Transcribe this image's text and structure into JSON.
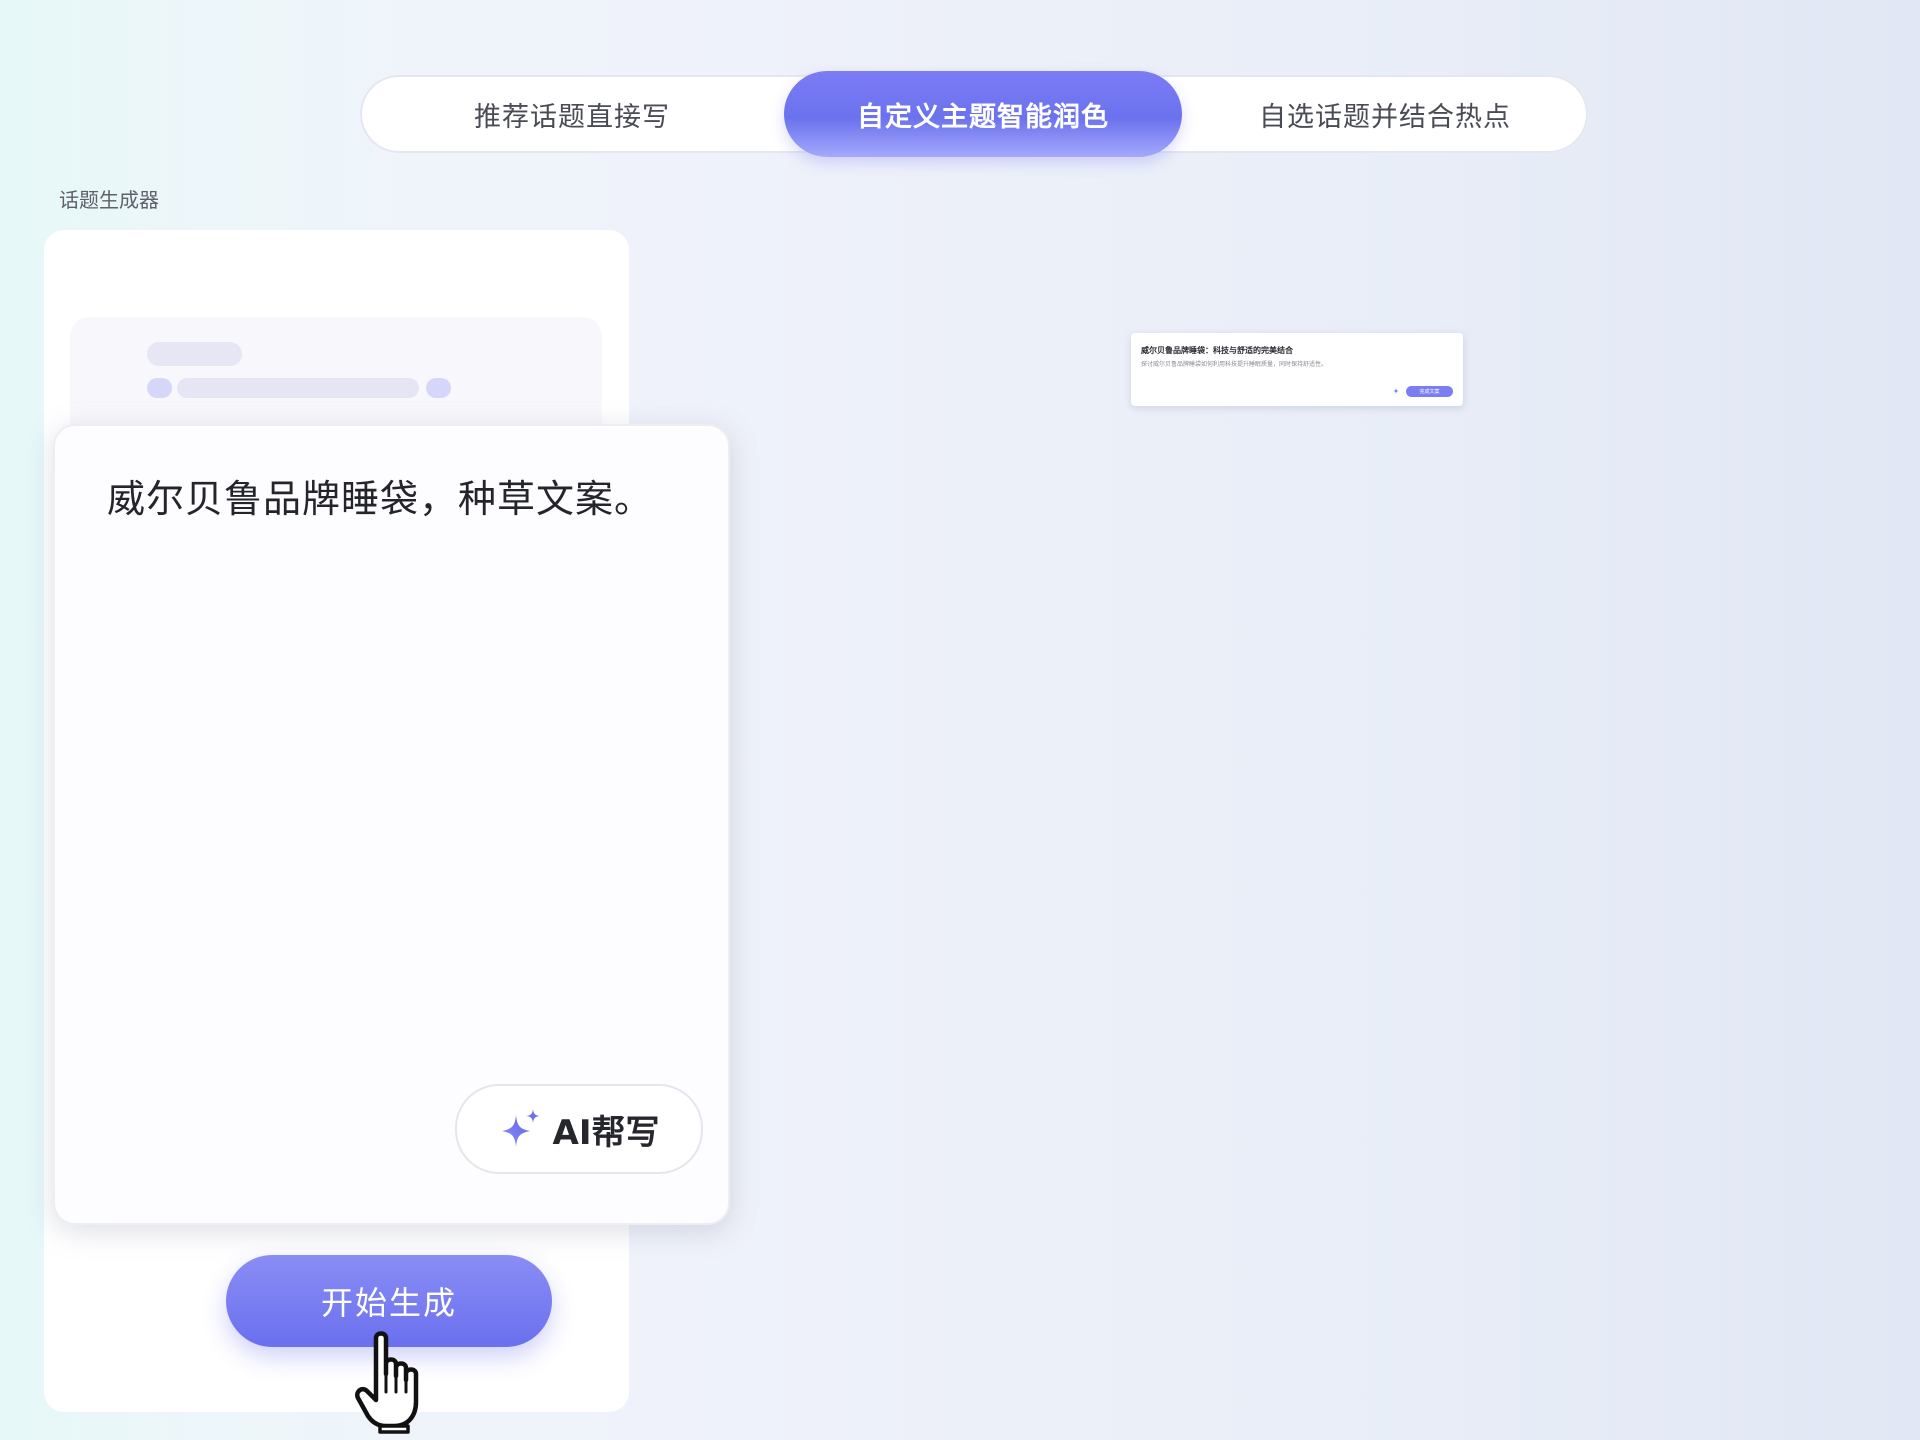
{
  "tabs": [
    {
      "label": "推荐话题直接写",
      "active": false
    },
    {
      "label": "自定义主题智能润色",
      "active": true
    },
    {
      "label": "自选话题并结合热点",
      "active": false
    }
  ],
  "section": {
    "label": "话题生成器"
  },
  "editor": {
    "text": "威尔贝鲁品牌睡袋，种草文案。",
    "ai_button_label": "AI帮写",
    "ai_button_icon": "sparkle-icon"
  },
  "actions": {
    "start_label": "开始生成"
  },
  "preview": {
    "title": "威尔贝鲁品牌睡袋：科技与舒适的完美结合",
    "subtitle": "探讨威尔贝鲁品牌睡袋如何利用科技提升睡眠质量，同时保持舒适性。",
    "button_label": "完成文案"
  },
  "colors": {
    "accent": "#6b72ee",
    "accent_light": "#a4a9fb"
  }
}
